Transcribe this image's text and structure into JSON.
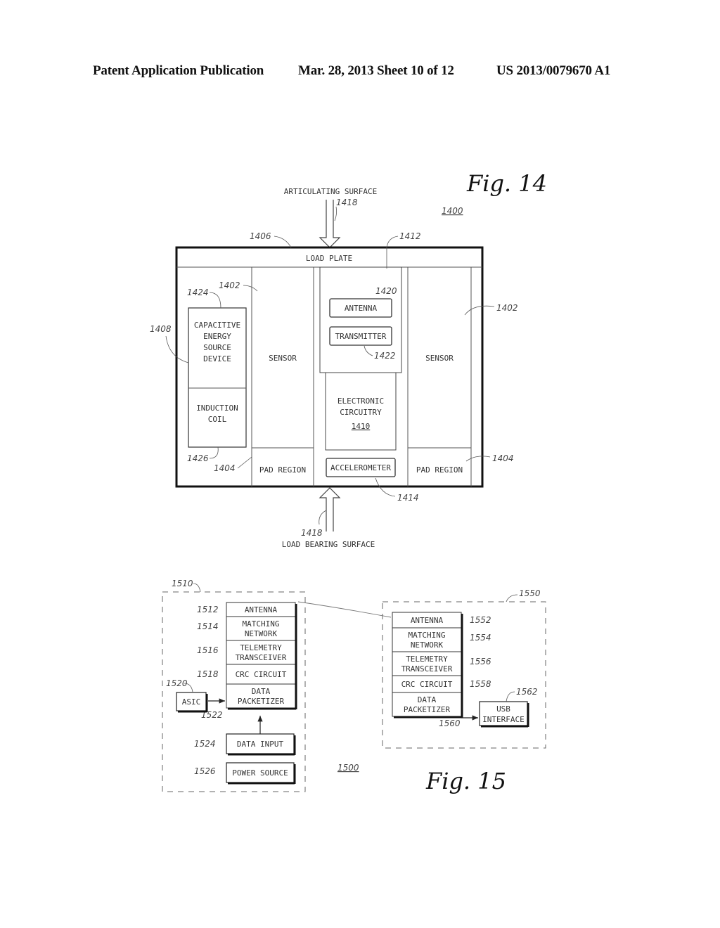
{
  "header": {
    "publication_type": "Patent Application Publication",
    "date_sheet": "Mar. 28, 2013  Sheet 10 of 12",
    "publication_number": "US 2013/0079670 A1"
  },
  "fig14": {
    "title": "Fig. 14",
    "figure_ref": "1400",
    "top_arrow_label": "ARTICULATING SURFACE",
    "top_arrow_ref": "1418",
    "bottom_arrow_label": "LOAD BEARING SURFACE",
    "bottom_arrow_ref": "1418",
    "load_plate": {
      "label": "LOAD PLATE",
      "ref": "1406"
    },
    "left_sensor": {
      "label": "SENSOR",
      "ref": "1402"
    },
    "right_sensor": {
      "label": "SENSOR",
      "ref": "1402"
    },
    "left_pad": {
      "label": "PAD REGION",
      "ref": "1404"
    },
    "right_pad": {
      "label": "PAD REGION",
      "ref": "1404"
    },
    "enclosure_ref": "1408",
    "capacitive": {
      "lines": [
        "CAPACITIVE",
        "ENERGY",
        "SOURCE",
        "DEVICE"
      ],
      "ref": "1424"
    },
    "induction": {
      "lines": [
        "INDUCTION",
        "COIL"
      ],
      "ref": "1426"
    },
    "module_ref": "1412",
    "antenna": {
      "label": "ANTENNA",
      "ref": "1420"
    },
    "transmitter": {
      "label": "TRANSMITTER",
      "ref": "1422"
    },
    "electronics": {
      "lines": [
        "ELECTRONIC",
        "CIRCUITRY"
      ],
      "ref": "1410"
    },
    "accelerometer": {
      "label": "ACCELEROMETER",
      "ref": "1414"
    }
  },
  "fig15": {
    "title": "Fig. 15",
    "figure_ref": "1500",
    "left_group_ref": "1510",
    "right_group_ref": "1550",
    "left_stack": [
      {
        "lines": [
          "ANTENNA"
        ],
        "ref": "1512"
      },
      {
        "lines": [
          "MATCHING",
          "NETWORK"
        ],
        "ref": "1514"
      },
      {
        "lines": [
          "TELEMETRY",
          "TRANSCEIVER"
        ],
        "ref": "1516"
      },
      {
        "lines": [
          "CRC CIRCUIT"
        ],
        "ref": "1518"
      },
      {
        "lines": [
          "DATA",
          "PACKETIZER"
        ],
        "ref": "1522"
      }
    ],
    "asic": {
      "label": "ASIC",
      "ref": "1520"
    },
    "data_input": {
      "label": "DATA INPUT",
      "ref": "1524"
    },
    "power_source": {
      "label": "POWER SOURCE",
      "ref": "1526"
    },
    "right_stack": [
      {
        "lines": [
          "ANTENNA"
        ],
        "ref": "1552"
      },
      {
        "lines": [
          "MATCHING",
          "NETWORK"
        ],
        "ref": "1554"
      },
      {
        "lines": [
          "TELEMETRY",
          "TRANSCEIVER"
        ],
        "ref": "1556"
      },
      {
        "lines": [
          "CRC CIRCUIT"
        ],
        "ref": "1558"
      },
      {
        "lines": [
          "DATA",
          "PACKETIZER"
        ],
        "ref": "1560"
      }
    ],
    "usb": {
      "lines": [
        "USB",
        "INTERFACE"
      ],
      "ref": "1562"
    }
  }
}
